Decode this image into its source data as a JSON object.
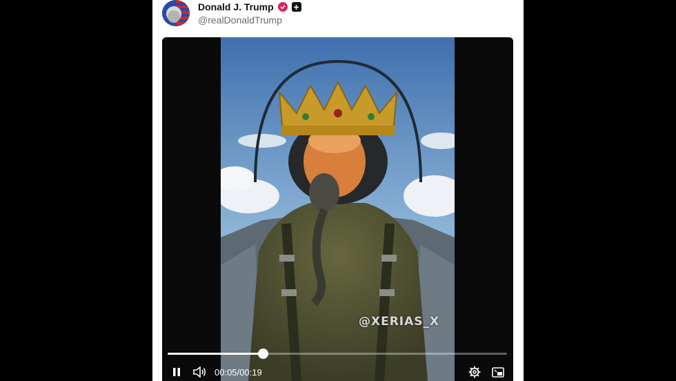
{
  "post": {
    "display_name": "Donald J. Trump",
    "handle": "@realDonaldTrump",
    "verified_color": "#e0245e"
  },
  "video": {
    "watermark": "@XERIAS_X",
    "current_time": "00:05",
    "separator": "/",
    "duration": "00:19",
    "progress_fraction": 0.28,
    "state": "playing"
  },
  "icons": {
    "play_state": "pause-icon",
    "volume": "volume-icon",
    "settings": "gear-icon",
    "pip": "picture-in-picture-icon",
    "plus": "plus-icon"
  }
}
